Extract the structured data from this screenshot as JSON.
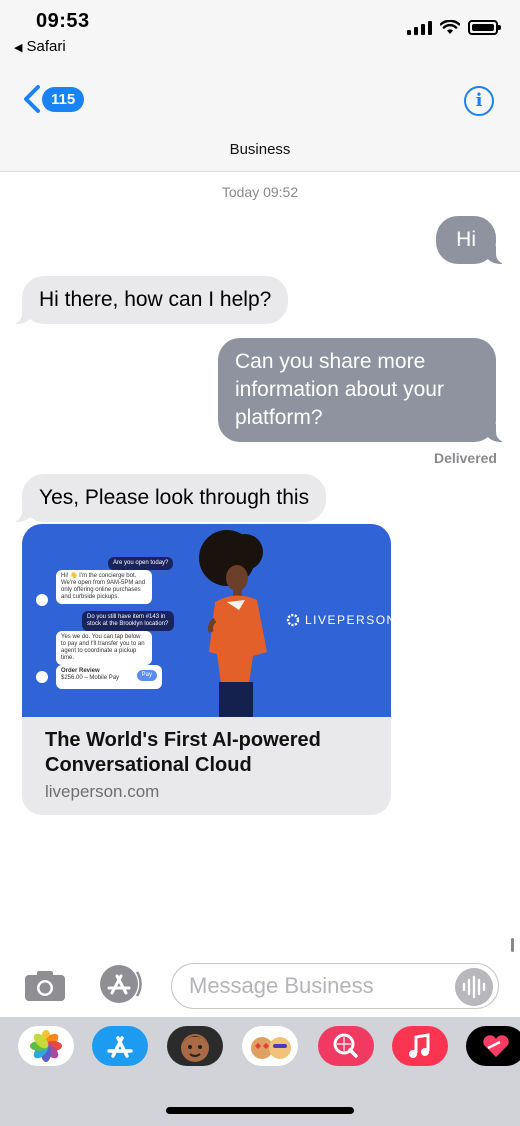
{
  "status_bar": {
    "time": "09:53",
    "back_app": "Safari"
  },
  "nav": {
    "back_count": "115",
    "contact_name": "Business",
    "info_label": "i"
  },
  "conversation": {
    "timestamp": "Today 09:52",
    "messages": [
      {
        "from": "me",
        "text": "Hi"
      },
      {
        "from": "them",
        "text": "Hi there, how can I help?"
      },
      {
        "from": "me",
        "text": "Can you share more information about your platform?"
      },
      {
        "from": "them",
        "text": "Yes, Please look through this"
      }
    ],
    "delivered_label": "Delivered"
  },
  "link_preview": {
    "title": "The World's First AI-powered Conversational Cloud",
    "domain": "liveperson.com",
    "image": {
      "brand": "LIVEPERSON",
      "chat": [
        {
          "side": "right",
          "text": "Are you open today?"
        },
        {
          "side": "left",
          "text": "Hi! 👋 I'm the concierge bot. We're open from 9AM-5PM and only offering online purchases and curbside pickups."
        },
        {
          "side": "right",
          "text": "Do you still have item #143 in stock at the Brooklyn location?"
        },
        {
          "side": "left",
          "text": "Yes we do. You can tap below to pay and I'll transfer you to an agent to coordinate a pickup time."
        }
      ],
      "order_card": {
        "title": "Order Review",
        "detail": "$256.00 – Mobile Pay",
        "pay_label": "Pay"
      }
    }
  },
  "composer": {
    "placeholder": "Message Business"
  },
  "app_drawer": {
    "apps": [
      "photos-app",
      "app-store-app",
      "memoji-app",
      "memoji-stickers-app",
      "images-search-app",
      "music-app",
      "digital-touch-app"
    ]
  },
  "colors": {
    "accent": "#1a82f7",
    "outgoing_bubble": "#8e939f",
    "incoming_bubble": "#e9e9eb",
    "preview_bg": "#2f63d6"
  }
}
